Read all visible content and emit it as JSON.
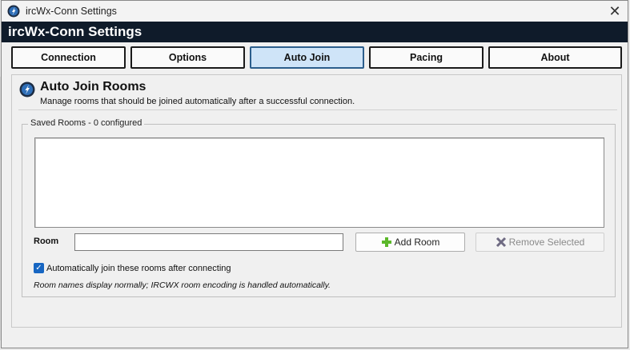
{
  "window": {
    "title": "ircWx-Conn Settings",
    "close_glyph": "✕"
  },
  "header": {
    "title": "ircWx-Conn Settings"
  },
  "tabs": [
    {
      "label": "Connection",
      "active": false
    },
    {
      "label": "Options",
      "active": false
    },
    {
      "label": "Auto Join",
      "active": true
    },
    {
      "label": "Pacing",
      "active": false
    },
    {
      "label": "About",
      "active": false
    }
  ],
  "section": {
    "icon": "app-logo-icon",
    "title": "Auto Join Rooms",
    "subtitle": "Manage rooms that should be joined automatically after a successful connection."
  },
  "saved_rooms": {
    "legend": "Saved Rooms - 0 configured",
    "items": []
  },
  "room_input": {
    "label": "Room",
    "value": "",
    "placeholder": ""
  },
  "buttons": {
    "add_label": "Add Room",
    "add_icon": "plus-icon",
    "remove_label": "Remove Selected",
    "remove_icon": "x-icon",
    "remove_enabled": false
  },
  "auto_join": {
    "label": "Automatically join these rooms after connecting",
    "checked": true
  },
  "footnote": "Room names display normally; IRCWX room encoding is handled automatically.",
  "colors": {
    "header_band": "#0f1b2a",
    "active_tab": "#cfe4f8",
    "checkbox": "#1766c2",
    "add_icon": "#5cb82a",
    "remove_icon": "#6e6a82"
  }
}
